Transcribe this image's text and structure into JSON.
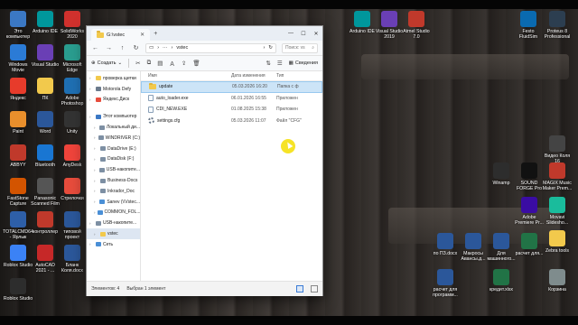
{
  "desktop": {
    "left_icons": [
      {
        "label": "Это компьютер",
        "icon": "computer-icon",
        "color": "#3b78c4"
      },
      {
        "label": "Arduino IDE",
        "icon": "arduino-icon",
        "color": "#00979c"
      },
      {
        "label": "SolidWorks 2020",
        "icon": "solidworks-icon",
        "color": "#d0312d"
      },
      {
        "label": "Windows Movie",
        "icon": "video-icon",
        "color": "#2b7bd6"
      },
      {
        "label": "Visual Studio",
        "icon": "vs-icon",
        "color": "#6a3fb5"
      },
      {
        "label": "Microsoft Edge",
        "icon": "edge-icon",
        "color": "#2a9d8f"
      },
      {
        "label": "Яндекс",
        "icon": "yandex-icon",
        "color": "#e73b2b"
      },
      {
        "label": "ПК",
        "icon": "folder-icon",
        "color": "#f2c94c"
      },
      {
        "label": "Adobe Photoshop",
        "icon": "ps-icon",
        "color": "#1f6fb2"
      },
      {
        "label": "Paint",
        "icon": "paint-icon",
        "color": "#e98f2c"
      },
      {
        "label": "Word",
        "icon": "word-icon",
        "color": "#2b579a"
      },
      {
        "label": "Unity",
        "icon": "unity-icon",
        "color": "#333333"
      },
      {
        "label": "ABBYY",
        "icon": "abbyy-icon",
        "color": "#c0392b"
      },
      {
        "label": "Bluetooth",
        "icon": "bluetooth-icon",
        "color": "#1976d2"
      },
      {
        "label": "AnyDesk",
        "icon": "anydesk-icon",
        "color": "#ef443b"
      },
      {
        "label": "FastStone Capture",
        "icon": "faststone-icon",
        "color": "#d35400"
      },
      {
        "label": "Panasonic Scanned Film",
        "icon": "panasonic-icon",
        "color": "#555555"
      },
      {
        "label": "Стрелочки",
        "icon": "app-icon",
        "color": "#e74c3c"
      },
      {
        "label": "TOTALCMD64 - Ярлык",
        "icon": "totalcmd-icon",
        "color": "#2e5fa8"
      },
      {
        "label": "контроллер",
        "icon": "app-icon",
        "color": "#c0392b"
      },
      {
        "label": "типовой проект",
        "icon": "word-icon",
        "color": "#2b579a"
      },
      {
        "label": "Roblox Studio",
        "icon": "roblox-icon",
        "color": "#3b82f6"
      },
      {
        "label": "AutoCAD 2021 - ...",
        "icon": "autocad-icon",
        "color": "#c62828"
      },
      {
        "label": "Бланк Коля.docx",
        "icon": "word-icon",
        "color": "#2b579a"
      },
      {
        "label": "Roblox Studio",
        "icon": "roblox-icon",
        "color": "#2d2d2d"
      }
    ],
    "right_icons": [
      {
        "label": "Arduino IDE",
        "icon": "arduino-icon",
        "color": "#00979c"
      },
      {
        "label": "Visual Studio 2019",
        "icon": "vs-icon",
        "color": "#6a3fb5"
      },
      {
        "label": "Atmel Studio 7.0",
        "icon": "atmel-icon",
        "color": "#c0392b"
      },
      {
        "label": "Festo FluidSim",
        "icon": "festo-icon",
        "color": "#0a6ab0"
      },
      {
        "label": "Proteus 8 Professional",
        "icon": "proteus-icon",
        "color": "#2c3e50"
      },
      {
        "label": "Видео Коля 16",
        "icon": "video-icon",
        "color": "#444444"
      },
      {
        "label": "Winamp",
        "icon": "winamp-icon",
        "color": "#2d2d2d"
      },
      {
        "label": "SOUND FORGE Pro",
        "icon": "soundforge-icon",
        "color": "#111111"
      },
      {
        "label": "MAGIX Music Maker Prem...",
        "icon": "magix-icon",
        "color": "#c0392b"
      },
      {
        "label": "Adobe Premiere Pr...",
        "icon": "premiere-icon",
        "color": "#3a0ca3"
      },
      {
        "label": "Movavi Slidesho...",
        "icon": "movavi-icon",
        "color": "#1abc9c"
      },
      {
        "label": "Zebra tools",
        "icon": "folder-icon",
        "color": "#f2c94c"
      },
      {
        "label": "по ПЗ.docx",
        "icon": "word-icon",
        "color": "#2b579a"
      },
      {
        "label": "Макросы Авансы.д...",
        "icon": "word-icon",
        "color": "#2b579a"
      },
      {
        "label": "Для машинного...",
        "icon": "word-icon",
        "color": "#2b579a"
      },
      {
        "label": "расчет для...",
        "icon": "excel-icon",
        "color": "#217346"
      },
      {
        "label": "расчет для программ...",
        "icon": "word-icon",
        "color": "#2b579a"
      },
      {
        "label": "кредит.xlsx",
        "icon": "excel-icon",
        "color": "#217346"
      },
      {
        "label": "Корзина",
        "icon": "recycle-bin-icon",
        "color": "#7f8c8d"
      }
    ]
  },
  "explorer": {
    "tab_title": "G:\\vstec",
    "address": "vstec",
    "search_placeholder": "Поиск: vs",
    "new_button": "Создать",
    "view_button": "Сведения",
    "sidebar": [
      {
        "label": "проверка щетки",
        "indent": 0,
        "icon": "folder"
      },
      {
        "label": "Motorola Defy",
        "indent": 0,
        "icon": "phone"
      },
      {
        "label": "Яндекс.Диск",
        "indent": 0,
        "icon": "cloud"
      },
      {
        "label": "Этот компьютер",
        "indent": 0,
        "icon": "computer"
      },
      {
        "label": "Локальный ди...",
        "indent": 1,
        "icon": "drive"
      },
      {
        "label": "WINDRIVER (C:)",
        "indent": 1,
        "icon": "drive"
      },
      {
        "label": "DataDrive (E:)",
        "indent": 1,
        "icon": "drive"
      },
      {
        "label": "DataDisk (F:)",
        "indent": 1,
        "icon": "drive"
      },
      {
        "label": "USB-накопите...",
        "indent": 1,
        "icon": "usb"
      },
      {
        "label": "Business-Docs",
        "indent": 1,
        "icon": "drive"
      },
      {
        "label": "Inkrador_Doc",
        "indent": 1,
        "icon": "drive"
      },
      {
        "label": "Sanev (\\\\Vstec...",
        "indent": 1,
        "icon": "network"
      },
      {
        "label": "COMMON_FOL...",
        "indent": 1,
        "icon": "network"
      },
      {
        "label": "USB-накопите...",
        "indent": 0,
        "icon": "usb"
      },
      {
        "label": "vstec",
        "indent": 1,
        "icon": "folder",
        "selected": true
      },
      {
        "label": "Сеть",
        "indent": 0,
        "icon": "network"
      }
    ],
    "columns": [
      "Имя",
      "Дата изменения",
      "Тип"
    ],
    "files": [
      {
        "name": "update",
        "date": "05.03.2026 16:20",
        "type": "Папка с ф",
        "icon": "folder",
        "selected": true
      },
      {
        "name": "auto_loader.exe",
        "date": "06.01.2026 16:55",
        "type": "Приложен",
        "icon": "exe"
      },
      {
        "name": "CDI_NEW.EXE",
        "date": "01.08.2025 15:38",
        "type": "Приложен",
        "icon": "exe"
      },
      {
        "name": "settings.cfg",
        "date": "05.03.2026 11:07",
        "type": "Файл \"CFG\"",
        "icon": "cfg"
      }
    ],
    "status": {
      "count": "Элементов: 4",
      "selected": "Выбран 1 элемент"
    }
  }
}
